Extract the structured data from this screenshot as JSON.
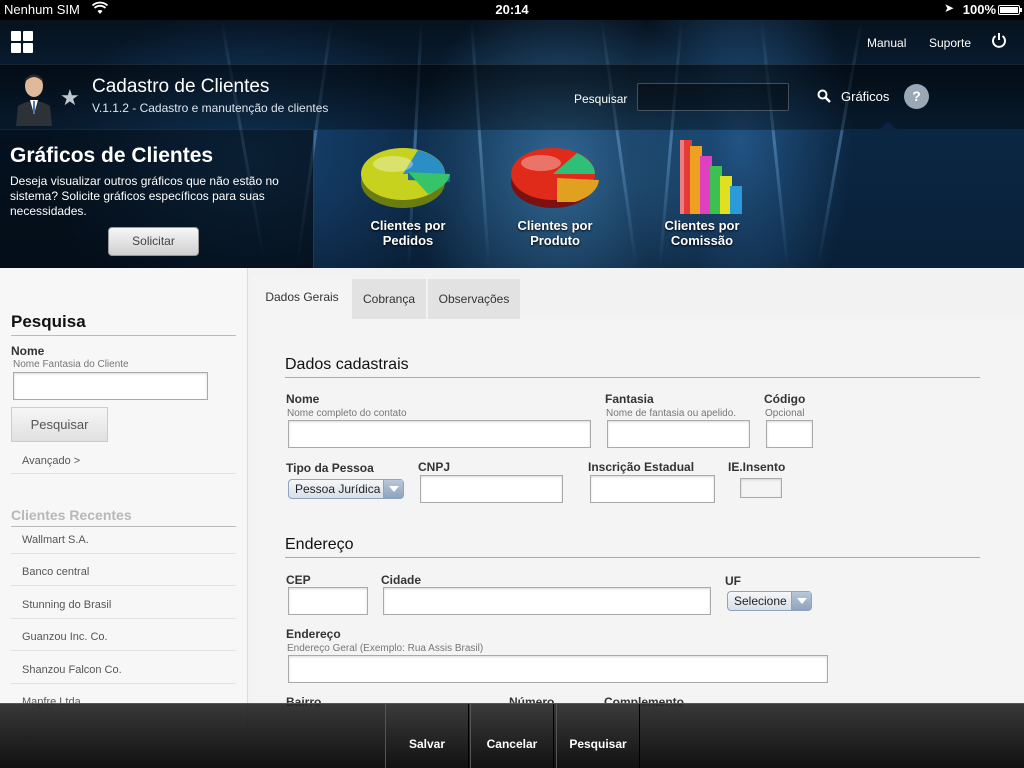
{
  "status_bar": {
    "carrier": "Nenhum SIM",
    "time": "20:14",
    "battery": "100%"
  },
  "top_nav": {
    "manual": "Manual",
    "suporte": "Suporte"
  },
  "app": {
    "title": "Cadastro de Clientes",
    "subtitle": "V.1.1.2 - Cadastro e manutenção de clientes"
  },
  "search": {
    "label": "Pesquisar",
    "value": ""
  },
  "graficos": {
    "label": "Gráficos",
    "help": "?"
  },
  "banner": {
    "title": "Gráficos de Clientes",
    "text": "Deseja visualizar outros gráficos que não estão no sistema? Solicite gráficos específicos para suas necessidades.",
    "button": "Solicitar",
    "charts": [
      {
        "line1": "Clientes por",
        "line2": "Pedidos"
      },
      {
        "line1": "Clientes por",
        "line2": "Produto"
      },
      {
        "line1": "Clientes por",
        "line2": "Comissão"
      }
    ]
  },
  "sidebar": {
    "title": "Pesquisa",
    "nome_label": "Nome",
    "nome_hint": "Nome Fantasia do Cliente",
    "nome_value": "",
    "search_button": "Pesquisar",
    "advanced": "Avançado >",
    "recent_title": "Clientes Recentes",
    "recent": [
      "Wallmart S.A.",
      "Banco central",
      "Stunning do Brasil",
      "Guanzou Inc. Co.",
      "Shanzou Falcon Co.",
      "Mapfre Ltda",
      "..."
    ]
  },
  "tabs": [
    "Dados Gerais",
    "Cobrança",
    "Observações"
  ],
  "form": {
    "dados_title": "Dados cadastrais",
    "nome_label": "Nome",
    "nome_hint": "Nome completo do contato",
    "nome_value": "",
    "fantasia_label": "Fantasia",
    "fantasia_hint": "Nome de fantasia ou apelido.",
    "fantasia_value": "",
    "codigo_label": "Código",
    "codigo_hint": "Opcional",
    "codigo_value": "",
    "tipo_label": "Tipo da Pessoa",
    "tipo_value": "Pessoa Jurídica",
    "cnpj_label": "CNPJ",
    "cnpj_value": "",
    "ie_label": "Inscrição Estadual",
    "ie_value": "",
    "isento_label": "IE.Insento",
    "endereco_title": "Endereço",
    "cep_label": "CEP",
    "cep_value": "",
    "cidade_label": "Cidade",
    "cidade_value": "",
    "uf_label": "UF",
    "uf_value": "Selecione",
    "end_label": "Endereço",
    "end_hint": "Endereço Geral (Exemplo: Rua Assis Brasil)",
    "end_value": "",
    "bairro_label": "Bairro",
    "numero_label": "Número",
    "complemento_label": "Complemento"
  },
  "toolbar": {
    "save": "Salvar",
    "cancel": "Cancelar",
    "search": "Pesquisar"
  }
}
